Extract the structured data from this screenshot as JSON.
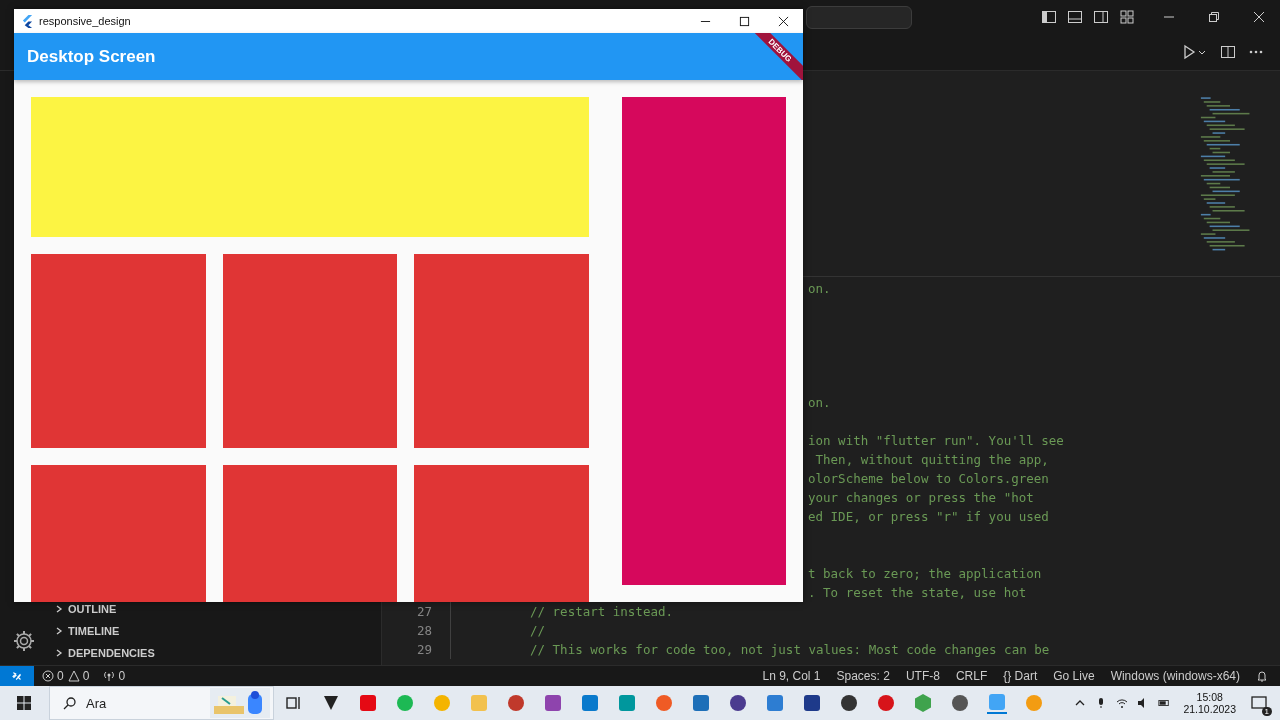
{
  "app_window": {
    "title": "responsive_design",
    "app_bar": {
      "title": "Desktop Screen"
    },
    "debug_banner": "DEBUG",
    "boxes": [
      {
        "kind": "banner",
        "color": "#fcf443"
      },
      {
        "kind": "tile",
        "color": "#e03535"
      },
      {
        "kind": "tile",
        "color": "#e03535"
      },
      {
        "kind": "tile",
        "color": "#e03535"
      },
      {
        "kind": "tile",
        "color": "#e03535"
      },
      {
        "kind": "tile",
        "color": "#e03535"
      },
      {
        "kind": "tile",
        "color": "#e03535"
      },
      {
        "kind": "sidebar",
        "color": "#d6085c"
      }
    ]
  },
  "sidebar": {
    "sections": [
      {
        "label": "OUTLINE",
        "expanded": false
      },
      {
        "label": "TIMELINE",
        "expanded": false
      },
      {
        "label": "DEPENDENCIES",
        "expanded": false
      }
    ]
  },
  "editor": {
    "partial_blocks": [
      [
        "on."
      ],
      [
        "on."
      ],
      [
        "ion with \"flutter run\". You'll see",
        " Then, without quitting the app,",
        "olorScheme below to Colors.green",
        "your changes or press the \"hot",
        "ed IDE, or press \"r\" if you used"
      ],
      [
        "t back to zero; the application",
        ". To reset the state, use hot"
      ]
    ],
    "lines": [
      {
        "number": "27",
        "text": "// restart instead."
      },
      {
        "number": "28",
        "text": "//"
      },
      {
        "number": "29",
        "text": "// This works for code too, not just values: Most code changes can be"
      }
    ]
  },
  "status_bar": {
    "errors": "0",
    "warnings": "0",
    "ports": "0",
    "items": [
      "Ln 9, Col 1",
      "Spaces: 2",
      "UTF-8",
      "CRLF",
      "{} Dart",
      "Go Live",
      "Windows (windows-x64)"
    ]
  },
  "taskbar": {
    "search": {
      "placeholder": "Ara"
    },
    "time": "15:08",
    "date": "21.10.2023",
    "notifications": "1"
  }
}
